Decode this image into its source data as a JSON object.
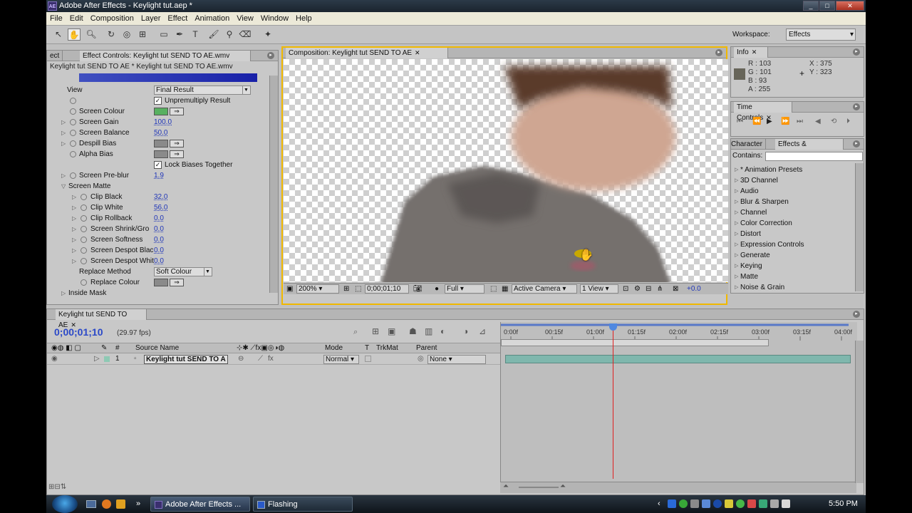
{
  "window": {
    "title": "Adobe After Effects - Keylight tut.aep *",
    "logo": "AE",
    "min": "_",
    "max": "□",
    "close": "✕"
  },
  "menu": [
    "File",
    "Edit",
    "Composition",
    "Layer",
    "Effect",
    "Animation",
    "View",
    "Window",
    "Help"
  ],
  "workspace": {
    "label": "Workspace:",
    "value": "Effects"
  },
  "effect_controls": {
    "tab_left": "ect",
    "tab": "Effect Controls: Keylight tut SEND TO AE.wmv",
    "subtitle": "Keylight tut SEND TO AE * Keylight tut SEND TO AE.wmv",
    "view": {
      "label": "View",
      "value": "Final Result"
    },
    "unpremultiply": "Unpremultiply Result",
    "screen_colour": "Screen Colour",
    "screen_gain": {
      "label": "Screen Gain",
      "value": "100.0"
    },
    "screen_balance": {
      "label": "Screen Balance",
      "value": "50.0"
    },
    "despill_bias": "Despill Bias",
    "alpha_bias": "Alpha Bias",
    "lock_biases": "Lock Biases Together",
    "screen_preblur": {
      "label": "Screen Pre-blur",
      "value": "1.9"
    },
    "screen_matte": "Screen Matte",
    "clip_black": {
      "label": "Clip Black",
      "value": "32.0"
    },
    "clip_white": {
      "label": "Clip White",
      "value": "56.0"
    },
    "clip_rollback": {
      "label": "Clip Rollback",
      "value": "0.0"
    },
    "shrink_grow": {
      "label": "Screen Shrink/Gro",
      "value": "0.0"
    },
    "softness": {
      "label": "Screen Softness",
      "value": "0.0"
    },
    "despot_black": {
      "label": "Screen Despot Blac",
      "value": "0.0"
    },
    "despot_white": {
      "label": "Screen Despot Whit",
      "value": "0.0"
    },
    "replace_method": {
      "label": "Replace Method",
      "value": "Soft Colour"
    },
    "replace_colour": "Replace Colour",
    "inside_mask": "Inside Mask"
  },
  "composition": {
    "tab": "Composition: Keylight tut SEND TO AE",
    "zoom": "200%",
    "timecode": "0;00;01;10",
    "resolution": "Full",
    "camera": "Active Camera",
    "views": "1 View",
    "exposure": "+0.0"
  },
  "info": {
    "tab": "Info",
    "r": "R : 103",
    "g": "G : 101",
    "b": "B : 93",
    "a": "A : 255",
    "x": "X : 375",
    "y": "Y : 323",
    "swatch": "#676559"
  },
  "time_controls": {
    "tab": "Time Controls"
  },
  "effects_presets": {
    "tab_left": "Character",
    "tab": "Effects & Presets",
    "contains": "Contains:",
    "items": [
      "* Animation Presets",
      "3D Channel",
      "Audio",
      "Blur & Sharpen",
      "Channel",
      "Color Correction",
      "Distort",
      "Expression Controls",
      "Generate",
      "Keying",
      "Matte",
      "Noise & Grain"
    ]
  },
  "timeline": {
    "tab": "Keylight tut SEND TO AE",
    "time": "0;00;01;10",
    "fps": "(29.97 fps)",
    "columns": {
      "num": "#",
      "source": "Source Name",
      "mode": "Mode",
      "t": "T",
      "trkmat": "TrkMat",
      "parent": "Parent"
    },
    "layer": {
      "num": "1",
      "name": "Keylight tut SEND TO A",
      "mode": "Normal",
      "parent": "None"
    },
    "ruler": [
      "0:00f",
      "00:15f",
      "01:00f",
      "01:15f",
      "02:00f",
      "02:15f",
      "03:00f",
      "03:15f",
      "04:00f"
    ],
    "current_time_fraction": 0.316
  },
  "taskbar": {
    "tasks": [
      "Adobe After Effects ...",
      "Flashing"
    ],
    "chevron": "»",
    "clock": "5:50 PM"
  },
  "colors": {
    "accent": "#2036b8",
    "highlight": "#f0b800",
    "layer": "#7fb7ad",
    "playhead": "#e02020"
  }
}
